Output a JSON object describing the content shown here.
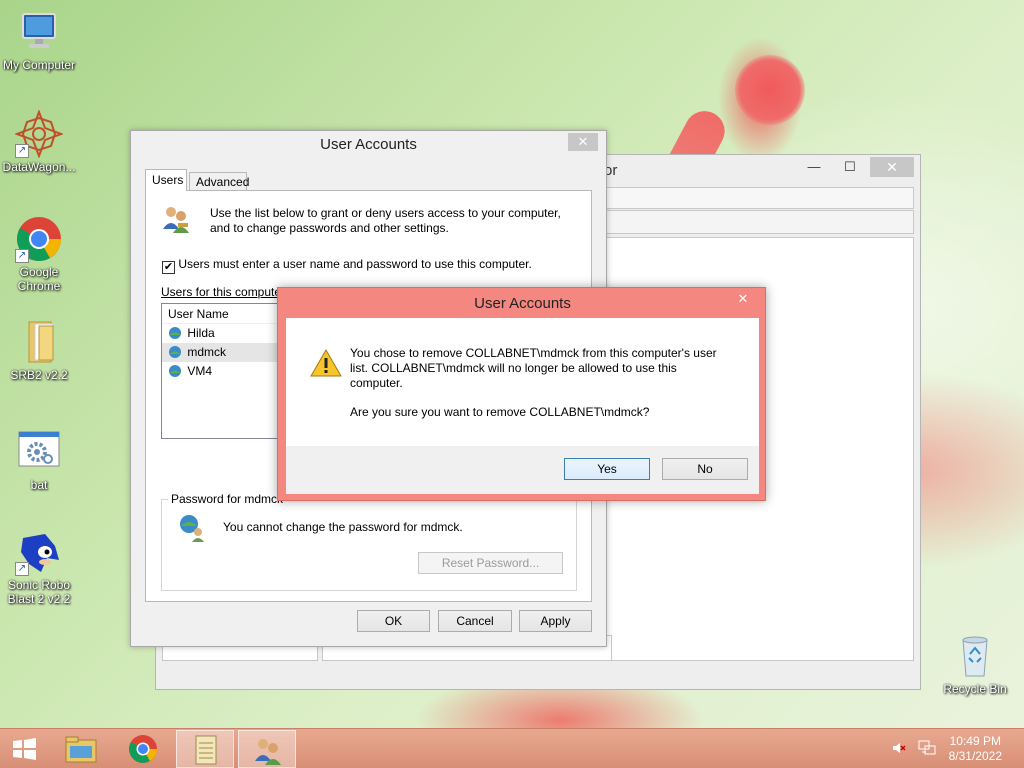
{
  "desktop": {
    "icons": [
      {
        "label": "My Computer"
      },
      {
        "label": "DataWagon..."
      },
      {
        "label": "Google Chrome"
      },
      {
        "label": "SRB2 v2.2"
      },
      {
        "label": "bat"
      },
      {
        "label": "Sonic Robo Blast 2 v2.2"
      },
      {
        "label": "Recycle Bin"
      }
    ]
  },
  "background_window": {
    "title_fragment": "or",
    "maximize_glyph": "☐",
    "minimize_glyph": "—",
    "close_glyph": "✕"
  },
  "user_accounts": {
    "title": "User Accounts",
    "close_glyph": "✕",
    "tabs": [
      {
        "label": "Users"
      },
      {
        "label": "Advanced"
      }
    ],
    "intro_text": "Use the list below to grant or deny users access to your computer, and to change passwords and other settings.",
    "must_enter_checkbox": {
      "checked": true,
      "label": "Users must enter a user name and password to use this computer."
    },
    "users_for_label": "Users for this compute",
    "list_header": "User Name",
    "users": [
      {
        "name": "Hilda",
        "selected": false
      },
      {
        "name": "mdmck",
        "selected": true
      },
      {
        "name": "VM4",
        "selected": false
      }
    ],
    "password_group_label": "Password for mdmck",
    "password_text": "You cannot change the password for mdmck.",
    "reset_password_button": "Reset Password...",
    "ok_button": "OK",
    "cancel_button": "Cancel",
    "apply_button": "Apply"
  },
  "confirm_dialog": {
    "title": "User Accounts",
    "close_glyph": "✕",
    "message": "You chose to remove COLLABNET\\mdmck from this computer's user list. COLLABNET\\mdmck will no longer be allowed to use this computer.",
    "question": "Are you sure you want to remove COLLABNET\\mdmck?",
    "yes_button": "Yes",
    "no_button": "No"
  },
  "taskbar": {
    "time": "10:49 PM",
    "date": "8/31/2022"
  },
  "colors": {
    "dialog_accent": "#f4877f",
    "taskbar": "#d78f76"
  }
}
